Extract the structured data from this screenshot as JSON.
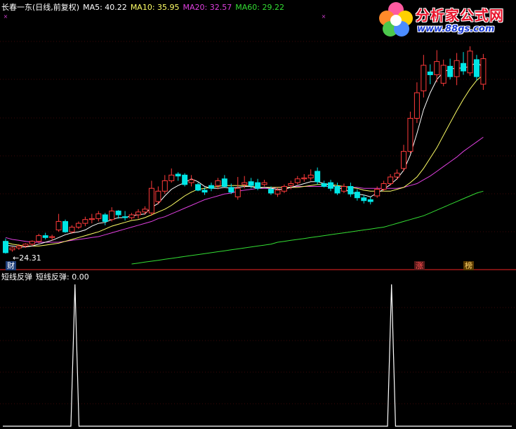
{
  "price_panel": {
    "stock_name": "长春一东(日线,前复权)",
    "ma5_text": "MA5: 40.22",
    "ma10_text": "MA10: 35.95",
    "ma20_text": "MA20: 32.57",
    "ma60_text": "MA60: 29.22",
    "low_marker_text": "←24.31",
    "tag_cai": "财",
    "tag_zhang": "涨",
    "tag_bang": "榜"
  },
  "indicator_panel": {
    "title": "短线反弹",
    "value_text": "短线反弹: 0.00"
  },
  "logo": {
    "title": "分析家公式网",
    "url": "www.88gs.com"
  },
  "colors": {
    "up": "#ff3a3a",
    "down": "#00e6e6",
    "ma5": "#ffffff",
    "ma10": "#ffff66",
    "ma20": "#e040e0",
    "ma60": "#33dd33",
    "grid": "#7a1010",
    "indicator": "#ffffff"
  },
  "chart_data": [
    {
      "type": "candlestick",
      "ylim": [
        23.5,
        46.5
      ],
      "series_ohlc": [
        [
          25.6,
          25.9,
          24.3,
          24.4
        ],
        [
          24.7,
          25.0,
          24.5,
          24.9
        ],
        [
          24.9,
          25.3,
          24.7,
          25.1
        ],
        [
          25.1,
          25.4,
          24.9,
          25.3
        ],
        [
          25.3,
          25.7,
          25.1,
          25.6
        ],
        [
          25.6,
          26.4,
          25.4,
          26.2
        ],
        [
          26.2,
          26.5,
          25.8,
          26.0
        ],
        [
          26.0,
          26.3,
          25.7,
          26.1
        ],
        [
          26.8,
          28.5,
          26.6,
          27.7
        ],
        [
          27.7,
          27.9,
          26.5,
          26.6
        ],
        [
          26.6,
          27.3,
          26.4,
          27.1
        ],
        [
          27.1,
          27.7,
          26.9,
          27.5
        ],
        [
          27.5,
          28.2,
          27.2,
          27.9
        ],
        [
          27.9,
          28.5,
          27.5,
          28.0
        ],
        [
          28.0,
          28.8,
          27.7,
          28.5
        ],
        [
          28.4,
          28.6,
          27.3,
          27.7
        ],
        [
          27.9,
          29.2,
          27.7,
          28.8
        ],
        [
          28.8,
          28.9,
          28.0,
          28.4
        ],
        [
          28.2,
          28.8,
          27.8,
          28.1
        ],
        [
          28.1,
          28.6,
          27.9,
          28.4
        ],
        [
          28.4,
          29.0,
          28.0,
          28.7
        ],
        [
          28.7,
          29.3,
          28.4,
          29.0
        ],
        [
          28.6,
          32.0,
          28.3,
          31.2
        ],
        [
          29.8,
          31.4,
          29.5,
          30.9
        ],
        [
          30.9,
          32.6,
          30.6,
          32.0
        ],
        [
          32.0,
          33.3,
          31.8,
          32.6
        ],
        [
          32.7,
          32.9,
          32.0,
          32.5
        ],
        [
          32.6,
          32.8,
          31.4,
          31.6
        ],
        [
          31.8,
          32.6,
          31.4,
          32.1
        ],
        [
          31.6,
          31.8,
          30.9,
          31.0
        ],
        [
          31.0,
          31.3,
          30.5,
          30.8
        ],
        [
          31.5,
          31.8,
          30.9,
          31.2
        ],
        [
          31.5,
          32.3,
          31.1,
          32.0
        ],
        [
          32.2,
          32.6,
          31.3,
          31.4
        ],
        [
          31.3,
          31.7,
          30.6,
          30.8
        ],
        [
          30.3,
          32.4,
          30.0,
          31.2
        ],
        [
          31.6,
          32.5,
          31.2,
          31.8
        ],
        [
          31.9,
          32.3,
          31.2,
          31.5
        ],
        [
          31.8,
          32.2,
          31.0,
          31.2
        ],
        [
          31.6,
          32.1,
          31.4,
          31.8
        ],
        [
          31.1,
          31.4,
          30.5,
          30.7
        ],
        [
          30.6,
          31.3,
          30.3,
          31.0
        ],
        [
          30.9,
          31.6,
          30.7,
          31.4
        ],
        [
          31.5,
          32.0,
          31.1,
          31.7
        ],
        [
          31.8,
          32.5,
          31.6,
          32.2
        ],
        [
          32.2,
          32.7,
          31.9,
          32.3
        ],
        [
          32.3,
          33.2,
          32.0,
          32.6
        ],
        [
          33.0,
          33.4,
          31.6,
          31.9
        ],
        [
          31.7,
          32.0,
          31.3,
          31.4
        ],
        [
          31.8,
          32.1,
          30.9,
          31.2
        ],
        [
          31.4,
          31.8,
          30.5,
          30.7
        ],
        [
          30.9,
          31.7,
          30.7,
          31.4
        ],
        [
          31.4,
          31.8,
          30.3,
          30.6
        ],
        [
          30.8,
          31.1,
          29.9,
          30.2
        ],
        [
          30.2,
          30.5,
          29.6,
          29.9
        ],
        [
          30.0,
          30.3,
          29.5,
          29.8
        ],
        [
          30.4,
          31.4,
          30.2,
          31.1
        ],
        [
          31.1,
          32.0,
          30.9,
          31.7
        ],
        [
          31.7,
          32.7,
          31.5,
          32.4
        ],
        [
          32.4,
          33.2,
          32.1,
          32.8
        ],
        [
          33.3,
          35.8,
          33.0,
          35.1
        ],
        [
          35.1,
          39.3,
          34.9,
          38.6
        ],
        [
          38.6,
          42.4,
          38.1,
          41.3
        ],
        [
          41.5,
          45.3,
          40.8,
          44.2
        ],
        [
          43.5,
          44.3,
          42.2,
          43.2
        ],
        [
          43.2,
          45.8,
          42.4,
          44.6
        ],
        [
          42.3,
          44.8,
          42.0,
          44.2
        ],
        [
          44.1,
          44.9,
          42.7,
          43.0
        ],
        [
          43.0,
          45.5,
          42.1,
          44.7
        ],
        [
          44.4,
          45.6,
          43.2,
          43.6
        ],
        [
          43.4,
          46.2,
          43.1,
          45.7
        ],
        [
          44.8,
          45.3,
          42.6,
          43.0
        ],
        [
          42.2,
          45.4,
          41.6,
          44.9
        ]
      ],
      "ma5": [
        25.2,
        25.1,
        25.0,
        25.0,
        25.1,
        25.3,
        25.5,
        25.7,
        26.0,
        26.3,
        26.5,
        26.6,
        26.8,
        27.2,
        27.5,
        27.6,
        27.9,
        28.1,
        28.1,
        28.3,
        28.4,
        28.5,
        29.2,
        29.6,
        30.4,
        31.1,
        31.5,
        31.8,
        32.2,
        31.9,
        31.4,
        31.2,
        31.2,
        31.3,
        31.2,
        31.3,
        31.4,
        31.4,
        31.2,
        31.3,
        31.2,
        31.1,
        31.1,
        31.3,
        31.5,
        31.7,
        31.9,
        31.9,
        31.7,
        31.6,
        31.3,
        31.1,
        30.8,
        30.6,
        30.5,
        30.3,
        30.7,
        31.1,
        31.6,
        32.2,
        33.1,
        34.7,
        37.0,
        39.5,
        41.3,
        42.7,
        43.5,
        43.8,
        43.9,
        43.9,
        44.1,
        44.5,
        44.0
      ],
      "ma10": [
        25.5,
        25.3,
        25.2,
        25.1,
        25.1,
        25.1,
        25.2,
        25.3,
        25.4,
        25.6,
        25.8,
        26.0,
        26.2,
        26.4,
        26.6,
        26.9,
        27.2,
        27.4,
        27.6,
        27.8,
        27.9,
        28.1,
        28.4,
        28.7,
        29.0,
        29.4,
        29.9,
        30.4,
        30.8,
        31.1,
        31.2,
        31.3,
        31.4,
        31.5,
        31.5,
        31.5,
        31.5,
        31.4,
        31.3,
        31.3,
        31.3,
        31.3,
        31.3,
        31.3,
        31.3,
        31.4,
        31.5,
        31.6,
        31.6,
        31.6,
        31.5,
        31.4,
        31.3,
        31.2,
        31.0,
        30.9,
        30.9,
        30.9,
        30.9,
        31.1,
        31.3,
        31.8,
        32.4,
        33.3,
        34.4,
        35.5,
        36.8,
        38.1,
        39.4,
        40.6,
        41.7,
        42.6,
        43.2
      ],
      "ma20": [
        26.0,
        25.8,
        25.7,
        25.6,
        25.5,
        25.5,
        25.5,
        25.5,
        25.5,
        25.6,
        25.7,
        25.8,
        25.9,
        26.0,
        26.1,
        26.3,
        26.5,
        26.7,
        26.9,
        27.1,
        27.3,
        27.5,
        27.7,
        28.0,
        28.2,
        28.5,
        28.8,
        29.1,
        29.4,
        29.7,
        30.0,
        30.2,
        30.4,
        30.6,
        30.7,
        30.9,
        31.0,
        31.1,
        31.2,
        31.2,
        31.2,
        31.3,
        31.3,
        31.3,
        31.4,
        31.4,
        31.4,
        31.4,
        31.4,
        31.4,
        31.4,
        31.4,
        31.3,
        31.3,
        31.2,
        31.2,
        31.2,
        31.2,
        31.2,
        31.2,
        31.3,
        31.5,
        31.7,
        32.1,
        32.5,
        33.0,
        33.5,
        34.0,
        34.5,
        35.1,
        35.6,
        36.1,
        36.6
      ],
      "ma60_start_index": 19,
      "ma60": [
        23.2,
        23.3,
        23.4,
        23.5,
        23.6,
        23.7,
        23.8,
        23.9,
        24.0,
        24.1,
        24.2,
        24.3,
        24.4,
        24.5,
        24.6,
        24.7,
        24.8,
        24.9,
        25.0,
        25.1,
        25.2,
        25.3,
        25.5,
        25.6,
        25.7,
        25.8,
        25.9,
        26.0,
        26.1,
        26.2,
        26.3,
        26.4,
        26.5,
        26.6,
        26.7,
        26.8,
        26.9,
        27.0,
        27.1,
        27.3,
        27.5,
        27.7,
        27.9,
        28.1,
        28.3,
        28.6,
        28.9,
        29.2,
        29.5,
        29.8,
        30.1,
        30.4,
        30.7,
        30.9
      ]
    },
    {
      "type": "line",
      "title": "短线反弹",
      "ylim": [
        0,
        1
      ],
      "signal_index": [
        18,
        97
      ],
      "points_total": 128
    }
  ]
}
